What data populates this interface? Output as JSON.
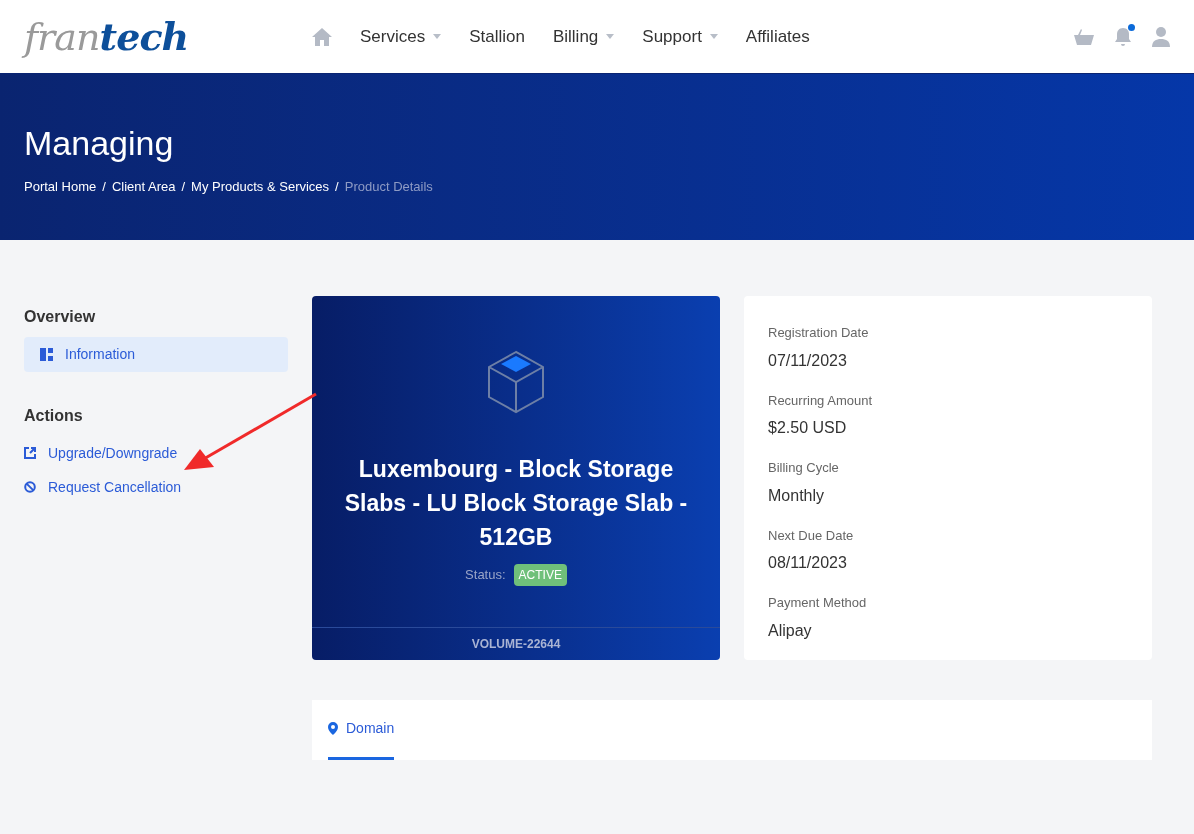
{
  "logo": {
    "text_1": "fran",
    "text_2": "tech"
  },
  "nav": [
    {
      "label": "Services",
      "has_menu": true
    },
    {
      "label": "Stallion",
      "has_menu": false
    },
    {
      "label": "Billing",
      "has_menu": true
    },
    {
      "label": "Support",
      "has_menu": true
    },
    {
      "label": "Affiliates",
      "has_menu": false
    }
  ],
  "notification_dot": true,
  "hero": {
    "title": "Managing",
    "separator": "/",
    "breadcrumb": [
      {
        "label": "Portal Home",
        "current": false
      },
      {
        "label": "Client Area",
        "current": false
      },
      {
        "label": "My Products & Services",
        "current": false
      },
      {
        "label": "Product Details",
        "current": true
      }
    ]
  },
  "sidebar": {
    "overview_title": "Overview",
    "overview_items": [
      {
        "label": "Information",
        "selected": true
      }
    ],
    "actions_title": "Actions",
    "actions": [
      {
        "label": "Upgrade/Downgrade"
      },
      {
        "label": "Request Cancellation"
      }
    ]
  },
  "product": {
    "name": "Luxembourg - Block Storage Slabs - LU Block Storage Slab - 512GB",
    "status_label": "Status:",
    "status": "ACTIVE",
    "id": "VOLUME-22644"
  },
  "details": [
    {
      "label": "Registration Date",
      "value": "07/11/2023"
    },
    {
      "label": "Recurring Amount",
      "value": "$2.50 USD"
    },
    {
      "label": "Billing Cycle",
      "value": "Monthly"
    },
    {
      "label": "Next Due Date",
      "value": "08/11/2023"
    },
    {
      "label": "Payment Method",
      "value": "Alipay"
    }
  ],
  "tabs": [
    {
      "label": "Domain",
      "selected": true
    }
  ]
}
